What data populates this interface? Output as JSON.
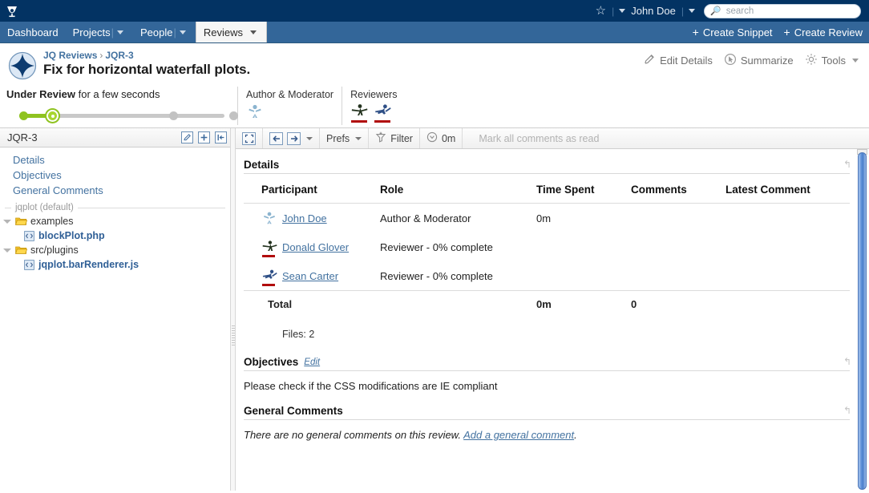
{
  "topbar": {
    "logo_icon": "swarm-logo-icon",
    "star_icon": "star-icon",
    "user_name": "John Doe",
    "search_placeholder": "search",
    "search_value": "",
    "search_icon": "search-icon"
  },
  "nav": {
    "tabs": [
      {
        "label": "Dashboard",
        "has_caret": false,
        "active": false
      },
      {
        "label": "Projects",
        "has_caret": true,
        "active": false
      },
      {
        "label": "People",
        "has_caret": true,
        "active": false
      },
      {
        "label": "Reviews",
        "has_caret": true,
        "active": true
      }
    ],
    "actions": [
      {
        "label": "Create Snippet",
        "icon": "plus-icon"
      },
      {
        "label": "Create Review",
        "icon": "plus-icon"
      }
    ]
  },
  "review": {
    "avatar_icon": "review-diamond-icon",
    "breadcrumb_root": "JQ Reviews",
    "breadcrumb_sep": "›",
    "breadcrumb_id": "JQR-3",
    "title": "Fix for horizontal waterfall plots.",
    "actions": [
      {
        "label": "Edit Details",
        "icon": "pencil-icon"
      },
      {
        "label": "Summarize",
        "icon": "summarize-icon"
      },
      {
        "label": "Tools",
        "icon": "gear-icon",
        "has_caret": true
      }
    ]
  },
  "status": {
    "state": "Under Review",
    "since": "for a few seconds",
    "slider": {
      "steps": 4,
      "current_step": 2,
      "fill_color": "#8fc320",
      "track_color": "#c9c9c9"
    },
    "author_label": "Author & Moderator",
    "reviewers_label": "Reviewers",
    "author_avatars": [
      "john-doe-avatar"
    ],
    "reviewer_avatars": [
      "donald-glover-avatar",
      "sean-carter-avatar"
    ]
  },
  "sidebar": {
    "title": "JQR-3",
    "buttons": [
      {
        "icon": "edit-pencil-icon"
      },
      {
        "icon": "plus-icon"
      },
      {
        "icon": "collapse-left-icon"
      }
    ],
    "links": [
      "Details",
      "Objectives",
      "General Comments"
    ],
    "tree_label": "jqplot (default)",
    "tree": [
      {
        "type": "folder",
        "name": "examples",
        "icon": "folder-icon",
        "expanded": true,
        "children": [
          {
            "type": "file",
            "name": "blockPlot.php",
            "icon": "code-file-icon"
          }
        ]
      },
      {
        "type": "folder",
        "name": "src/plugins",
        "icon": "folder-icon",
        "expanded": true,
        "children": [
          {
            "type": "file",
            "name": "jqplot.barRenderer.js",
            "icon": "code-file-icon"
          }
        ]
      }
    ]
  },
  "toolbar": {
    "expand_icon": "fullscreen-icon",
    "prev_icon": "arrow-left-icon",
    "next_icon": "arrow-right-icon",
    "nav_caret_icon": "chevron-down-icon",
    "prefs_label": "Prefs",
    "filter_label": "Filter",
    "filter_icon": "funnel-icon",
    "time_label": "0m",
    "time_icon": "clock-icon",
    "mark_read_label": "Mark all comments as read"
  },
  "details": {
    "section_title": "Details",
    "collapse_icon": "collapse-section-icon",
    "columns": [
      "Participant",
      "Role",
      "Time Spent",
      "Comments",
      "Latest Comment"
    ],
    "rows": [
      {
        "avatar": "john-doe-avatar",
        "underline_color": "",
        "participant": "John Doe",
        "role": "Author & Moderator",
        "time_spent": "0m",
        "comments": "",
        "latest_comment": ""
      },
      {
        "avatar": "donald-glover-avatar",
        "underline_color": "#b10d0d",
        "participant": "Donald Glover",
        "role": "Reviewer - 0% complete",
        "time_spent": "",
        "comments": "",
        "latest_comment": ""
      },
      {
        "avatar": "sean-carter-avatar",
        "underline_color": "#b10d0d",
        "participant": "Sean Carter",
        "role": "Reviewer - 0% complete",
        "time_spent": "",
        "comments": "",
        "latest_comment": ""
      }
    ],
    "total_label": "Total",
    "total_time": "0m",
    "total_comments": "0",
    "files_label": "Files: 2"
  },
  "objectives": {
    "section_title": "Objectives",
    "edit_label": "Edit",
    "collapse_icon": "collapse-section-icon",
    "text": "Please check if the CSS modifications are IE compliant"
  },
  "general_comments": {
    "section_title": "General Comments",
    "collapse_icon": "collapse-section-icon",
    "empty_text": "There are no general comments on this review.",
    "add_link": "Add a general comment",
    "trailing_period": "."
  },
  "colors": {
    "topbar_bg": "#033363",
    "navbar_bg": "#336699",
    "link": "#4372a0",
    "status_green": "#8fc320",
    "avatar_underline": "#b10d0d",
    "scrollbar": "#5b8fd8"
  }
}
